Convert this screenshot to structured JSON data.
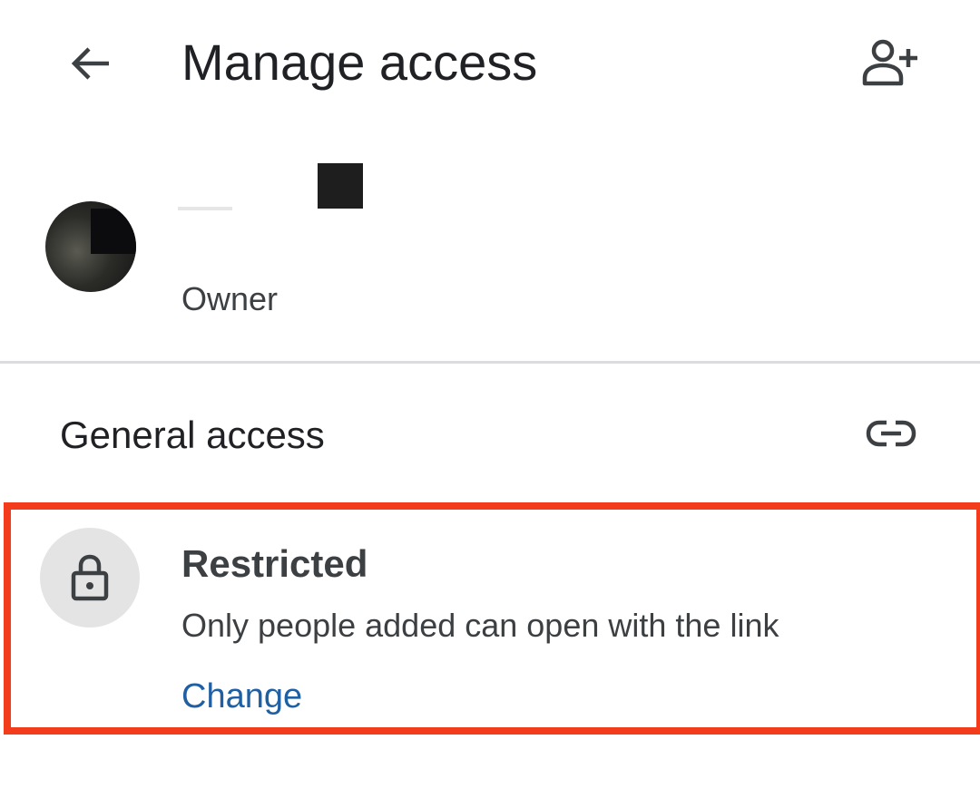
{
  "header": {
    "title": "Manage access",
    "back_icon": "arrow-left-icon",
    "add_people_icon": "person-add-icon"
  },
  "owner": {
    "role": "Owner"
  },
  "general_access": {
    "title": "General access",
    "link_icon": "link-icon",
    "option": {
      "icon": "lock-icon",
      "title": "Restricted",
      "description": "Only people added can open with the link",
      "action_label": "Change"
    }
  },
  "colors": {
    "highlight": "#f23c1c",
    "link": "#1f5fa3",
    "divider": "#dadce0"
  }
}
